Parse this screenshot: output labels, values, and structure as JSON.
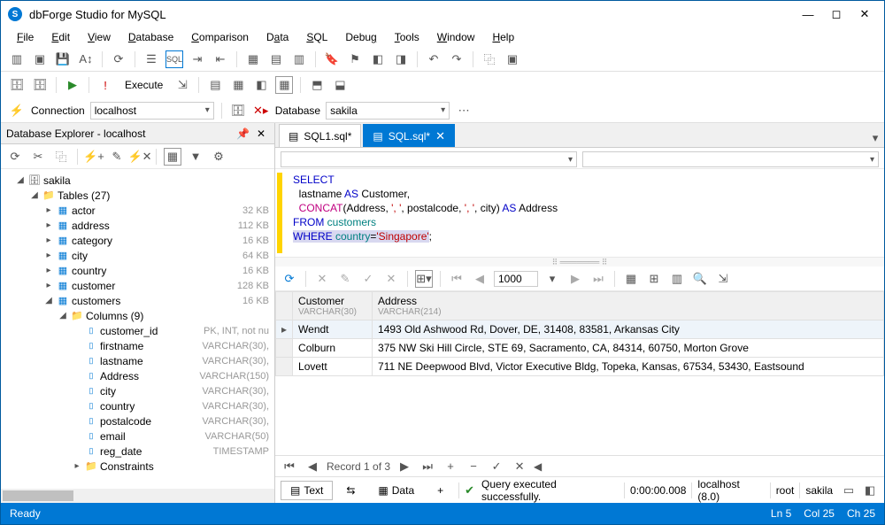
{
  "title": "dbForge Studio for MySQL",
  "menu": {
    "file": "File",
    "edit": "Edit",
    "view": "View",
    "database": "Database",
    "comparison": "Comparison",
    "data": "Data",
    "sql": "SQL",
    "debug": "Debug",
    "tools": "Tools",
    "window": "Window",
    "help": "Help"
  },
  "run": {
    "execute": "Execute"
  },
  "conn": {
    "label": "Connection",
    "value": "localhost",
    "db_label": "Database",
    "db_value": "sakila"
  },
  "explorer": {
    "title": "Database Explorer - localhost",
    "db": "sakila",
    "tables_label": "Tables (27)",
    "tables": [
      {
        "name": "actor",
        "size": "32 KB"
      },
      {
        "name": "address",
        "size": "112 KB"
      },
      {
        "name": "category",
        "size": "16 KB"
      },
      {
        "name": "city",
        "size": "64 KB"
      },
      {
        "name": "country",
        "size": "16 KB"
      },
      {
        "name": "customer",
        "size": "128 KB"
      },
      {
        "name": "customers",
        "size": "16 KB"
      }
    ],
    "columns_label": "Columns (9)",
    "columns": [
      {
        "name": "customer_id",
        "meta": "PK, INT, not nu"
      },
      {
        "name": "firstname",
        "meta": "VARCHAR(30),"
      },
      {
        "name": "lastname",
        "meta": "VARCHAR(30),"
      },
      {
        "name": "Address",
        "meta": "VARCHAR(150)"
      },
      {
        "name": "city",
        "meta": "VARCHAR(30),"
      },
      {
        "name": "country",
        "meta": "VARCHAR(30),"
      },
      {
        "name": "postalcode",
        "meta": "VARCHAR(30),"
      },
      {
        "name": "email",
        "meta": "VARCHAR(50)"
      },
      {
        "name": "reg_date",
        "meta": "TIMESTAMP"
      }
    ],
    "constraints": "Constraints"
  },
  "tabs": {
    "t1": "SQL1.sql*",
    "t2": "SQL.sql*"
  },
  "sql": {
    "l1a": "SELECT",
    "l2a": "  lastname ",
    "l2b": "AS",
    "l2c": " Customer,",
    "l3a": "  ",
    "l3b": "CONCAT",
    "l3c": "(Address, ",
    "l3d": "', '",
    "l3e": ", postalcode, ",
    "l3f": "', '",
    "l3g": ", city) ",
    "l3h": "AS",
    "l3i": " Address",
    "l4a": "FROM ",
    "l4b": "customers",
    "l5a": "WHERE ",
    "l5b": "country",
    "l5c": "=",
    "l5d": "'Singapore'",
    "l5e": ";"
  },
  "pager": {
    "value": "1000"
  },
  "grid": {
    "col1": "Customer",
    "col1_sub": "VARCHAR(30)",
    "col2": "Address",
    "col2_sub": "VARCHAR(214)",
    "rows": [
      {
        "c": "Wendt",
        "a": "1493 Old Ashwood Rd, Dover, DE, 31408, 83581, Arkansas City"
      },
      {
        "c": "Colburn",
        "a": "375 NW Ski Hill Circle, STE 69, Sacramento, CA, 84314, 60750, Morton Grove"
      },
      {
        "c": "Lovett",
        "a": "711 NE Deepwood Blvd, Victor Executive Bldg, Topeka, Kansas, 67534, 53430, Eastsound"
      }
    ]
  },
  "nav": {
    "record": "Record 1 of 3"
  },
  "bottom": {
    "text": "Text",
    "data": "Data",
    "success": "Query executed successfully.",
    "time": "0:00:00.008",
    "host": "localhost (8.0)",
    "user": "root",
    "schema": "sakila"
  },
  "status": {
    "ready": "Ready",
    "ln": "Ln 5",
    "col": "Col 25",
    "ch": "Ch 25"
  }
}
